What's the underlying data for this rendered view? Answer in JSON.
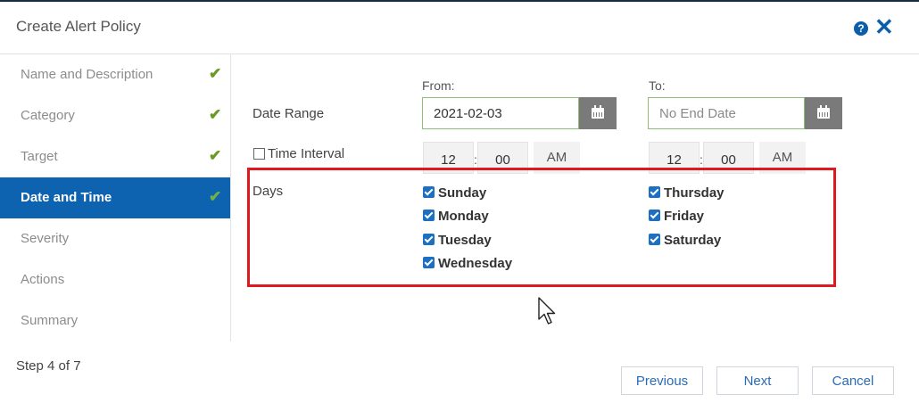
{
  "dialog": {
    "title": "Create Alert Policy",
    "help_icon": "?",
    "close_icon": "✕"
  },
  "sidebar": {
    "steps": [
      {
        "label": "Name and Description",
        "completed": true
      },
      {
        "label": "Category",
        "completed": true
      },
      {
        "label": "Target",
        "completed": true
      },
      {
        "label": "Date and Time",
        "completed": true,
        "active": true
      },
      {
        "label": "Severity",
        "completed": false
      },
      {
        "label": "Actions",
        "completed": false
      },
      {
        "label": "Summary",
        "completed": false
      }
    ],
    "check_glyph": "✔",
    "step_count": "Step 4 of 7"
  },
  "form": {
    "date_range": {
      "label": "Date Range",
      "from_label": "From:",
      "to_label": "To:",
      "from_value": "2021-02-03",
      "to_placeholder": "No End Date"
    },
    "time_interval": {
      "label": "Time Interval",
      "checked": false,
      "from": {
        "hour": "12",
        "minute": "00",
        "period": "AM"
      },
      "to": {
        "hour": "12",
        "minute": "00",
        "period": "AM"
      },
      "separator": ":"
    },
    "days": {
      "label": "Days",
      "items": [
        {
          "label": "Sunday",
          "checked": true
        },
        {
          "label": "Monday",
          "checked": true
        },
        {
          "label": "Tuesday",
          "checked": true
        },
        {
          "label": "Wednesday",
          "checked": true
        },
        {
          "label": "Thursday",
          "checked": true
        },
        {
          "label": "Friday",
          "checked": true
        },
        {
          "label": "Saturday",
          "checked": true
        }
      ]
    }
  },
  "footer": {
    "previous_label": "Previous",
    "next_label": "Next",
    "cancel_label": "Cancel"
  },
  "colors": {
    "accent": "#0d63b0",
    "check_green": "#6a9a24",
    "highlight_red": "#e0191f",
    "checkbox_blue": "#1c6fc1"
  },
  "icons": [
    "help-icon",
    "close-icon",
    "check-icon",
    "calendar-icon",
    "checkbox-icon",
    "mouse-cursor-icon"
  ]
}
